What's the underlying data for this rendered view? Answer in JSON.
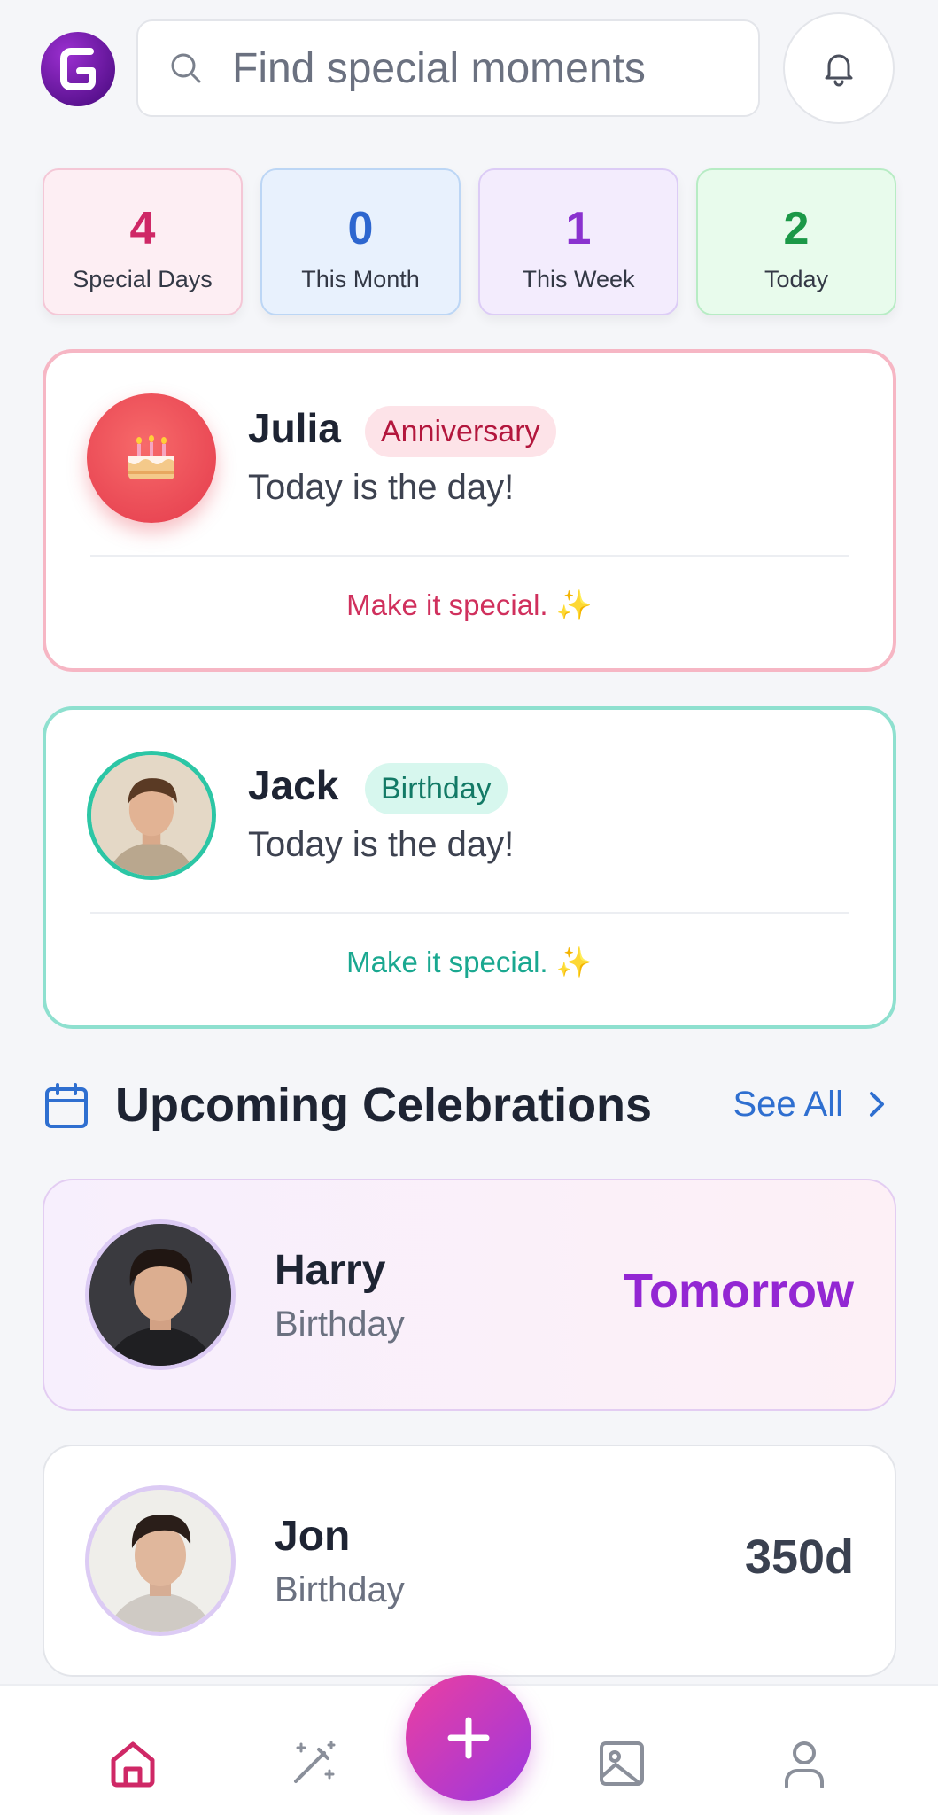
{
  "search": {
    "placeholder": "Find special moments"
  },
  "stats": [
    {
      "value": "4",
      "label": "Special Days"
    },
    {
      "value": "0",
      "label": "This Month"
    },
    {
      "value": "1",
      "label": "This Week"
    },
    {
      "value": "2",
      "label": "Today"
    }
  ],
  "today": [
    {
      "name": "Julia",
      "tag": "Anniversary",
      "subtitle": "Today is the day!",
      "cta": "Make it special.",
      "cta_emoji": "✨",
      "avatar_icon": "birthday-cake-icon"
    },
    {
      "name": "Jack",
      "tag": "Birthday",
      "subtitle": "Today is the day!",
      "cta": "Make it special.",
      "cta_emoji": "✨",
      "avatar_icon": "person-photo"
    }
  ],
  "upcoming": {
    "title": "Upcoming Celebrations",
    "see_all": "See All",
    "items": [
      {
        "name": "Harry",
        "type": "Birthday",
        "when": "Tomorrow"
      },
      {
        "name": "Jon",
        "type": "Birthday",
        "when": "350d"
      }
    ]
  },
  "logo_letter": "G",
  "nav": {
    "items": [
      "home-icon",
      "magic-wand-icon",
      "add-icon",
      "gallery-icon",
      "profile-icon"
    ],
    "active": "home-icon"
  },
  "colors": {
    "accent_pink": "#cf2866",
    "accent_blue": "#2d66cf",
    "accent_purple": "#8a32cf",
    "accent_green": "#1b9847",
    "teal": "#1aa890",
    "fab_gradient_start": "#ec3fa0",
    "fab_gradient_end": "#9b37e0"
  }
}
